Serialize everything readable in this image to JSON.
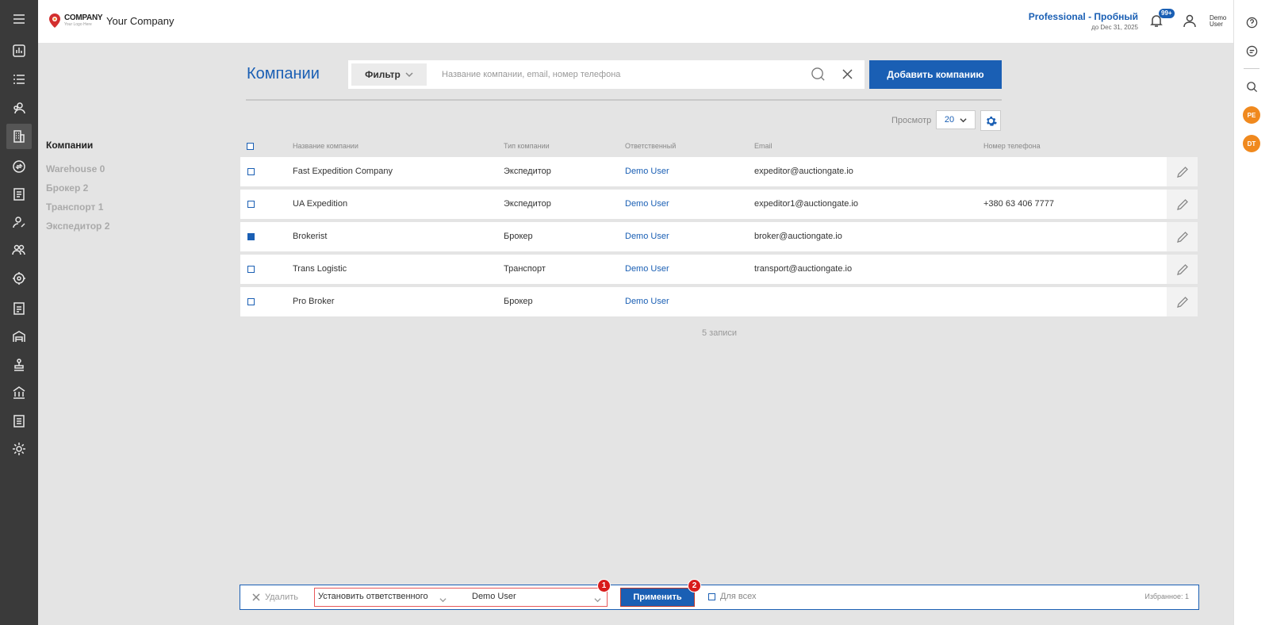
{
  "header": {
    "logo_big": "COMPANY",
    "logo_small": "Your Logo Here",
    "company_name": "Your Company",
    "plan_title": "Professional - Пробный",
    "plan_date": "до Dec 31, 2025",
    "notifications_badge": "99+",
    "user_name": "Demo User"
  },
  "left_nav": {
    "active": "Компании",
    "items": [
      "Warehouse 0",
      "Брокер 2",
      "Транспорт 1",
      "Экспедитор 2"
    ]
  },
  "page": {
    "title": "Компании",
    "filter_label": "Фильтр",
    "search_placeholder": "Название компании, email, номер телефона",
    "add_button": "Добавить компанию",
    "view_label": "Просмотр",
    "view_value": "20"
  },
  "table": {
    "columns": [
      "Название компании",
      "Тип компании",
      "Ответственный",
      "Email",
      "Номер телефона"
    ],
    "rows": [
      {
        "name": "Fast Expedition Company",
        "type": "Экспедитор",
        "owner": "Demo User",
        "email": "expeditor@auctiongate.io",
        "phone": "",
        "checked": false
      },
      {
        "name": "UA Expedition",
        "type": "Экспедитор",
        "owner": "Demo User",
        "email": "expeditor1@auctiongate.io",
        "phone": "+380 63 406 7777",
        "checked": false
      },
      {
        "name": "Brokerist",
        "type": "Брокер",
        "owner": "Demo User",
        "email": "broker@auctiongate.io",
        "phone": "",
        "checked": true
      },
      {
        "name": "Trans Logistic",
        "type": "Транспорт",
        "owner": "Demo User",
        "email": "transport@auctiongate.io",
        "phone": "",
        "checked": false
      },
      {
        "name": "Pro Broker",
        "type": "Брокер",
        "owner": "Demo User",
        "email": "",
        "phone": "",
        "checked": false
      }
    ],
    "records": "5 записи"
  },
  "bottom_bar": {
    "delete": "Удалить",
    "action": "Установить ответственного",
    "action_user": "Demo User",
    "apply": "Применить",
    "for_all": "Для всех",
    "favorites": "Избранное: 1",
    "step1": "1",
    "step2": "2"
  },
  "right_rail": {
    "avatars": [
      "PE",
      "DT"
    ]
  },
  "colors": {
    "accent": "#1a5fb4",
    "rail": "#3a3a3a",
    "avatar": "#f0891e",
    "step_badge": "#d81b1b"
  }
}
